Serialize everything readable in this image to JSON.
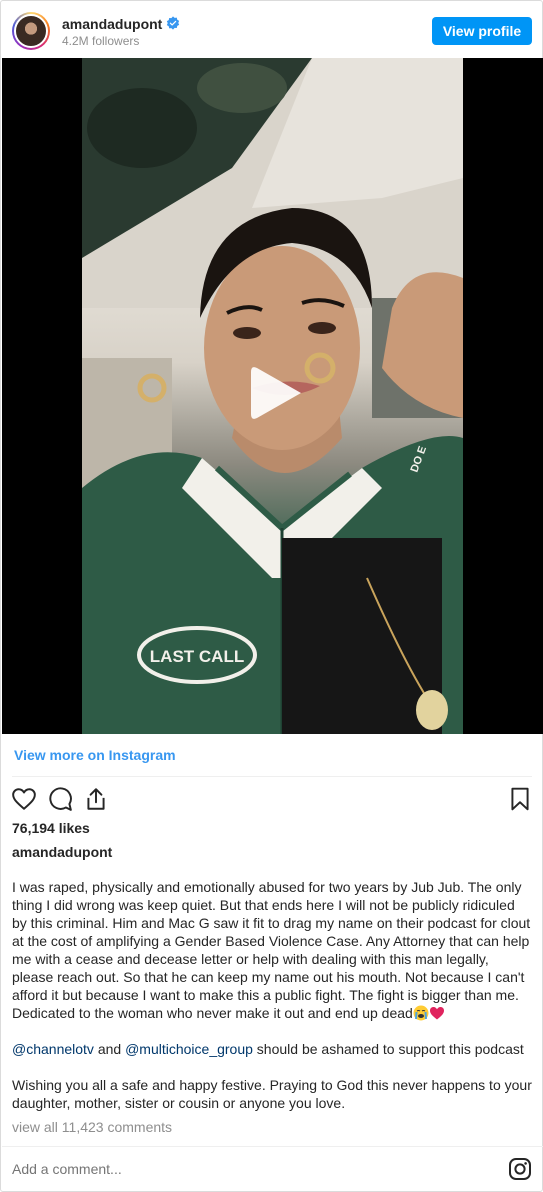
{
  "header": {
    "username": "amandadupont",
    "followers": "4.2M followers",
    "view_profile_label": "View profile"
  },
  "media": {
    "jacket_text": "LAST CALL",
    "sleeve_text": "DO E"
  },
  "view_more_label": "View more on Instagram",
  "likes": "76,194 likes",
  "caption": {
    "username": "amandadupont",
    "paragraph1": "I was raped, physically and emotionally abused for two years by Jub Jub. The only thing I did wrong was keep quiet. But that ends here I will not be publicly ridiculed by this criminal. Him and Mac G saw it fit to drag my name on their podcast for clout at the cost of amplifying a Gender Based Violence Case. Any Attorney that can help me with a cease and decease letter or help with dealing with this man legally, please reach out. So that he can keep my name out his mouth. Not because I can't afford it but because I want to make this a public fight. The fight is bigger than me. Dedicated to the woman who never make it out and end up dead",
    "mention1": "@channelotv",
    "and_text": " and ",
    "mention2": "@multichoice_group",
    "mention_tail": " should be ashamed to support this podcast",
    "paragraph3": "Wishing you all a safe and happy festive. Praying to God this never happens to your daughter, mother, sister or cousin or anyone you love."
  },
  "view_comments": "view all 11,423 comments",
  "comment_placeholder": "Add a comment...",
  "colors": {
    "accent": "#0095f6",
    "link": "#3897f0",
    "mention": "#00376b",
    "jacket_green": "#2e5b46"
  },
  "icons": [
    "verified-badge-icon",
    "play-icon",
    "heart-icon",
    "comment-icon",
    "share-icon",
    "bookmark-icon",
    "crying-face-icon",
    "red-heart-icon",
    "instagram-icon"
  ]
}
